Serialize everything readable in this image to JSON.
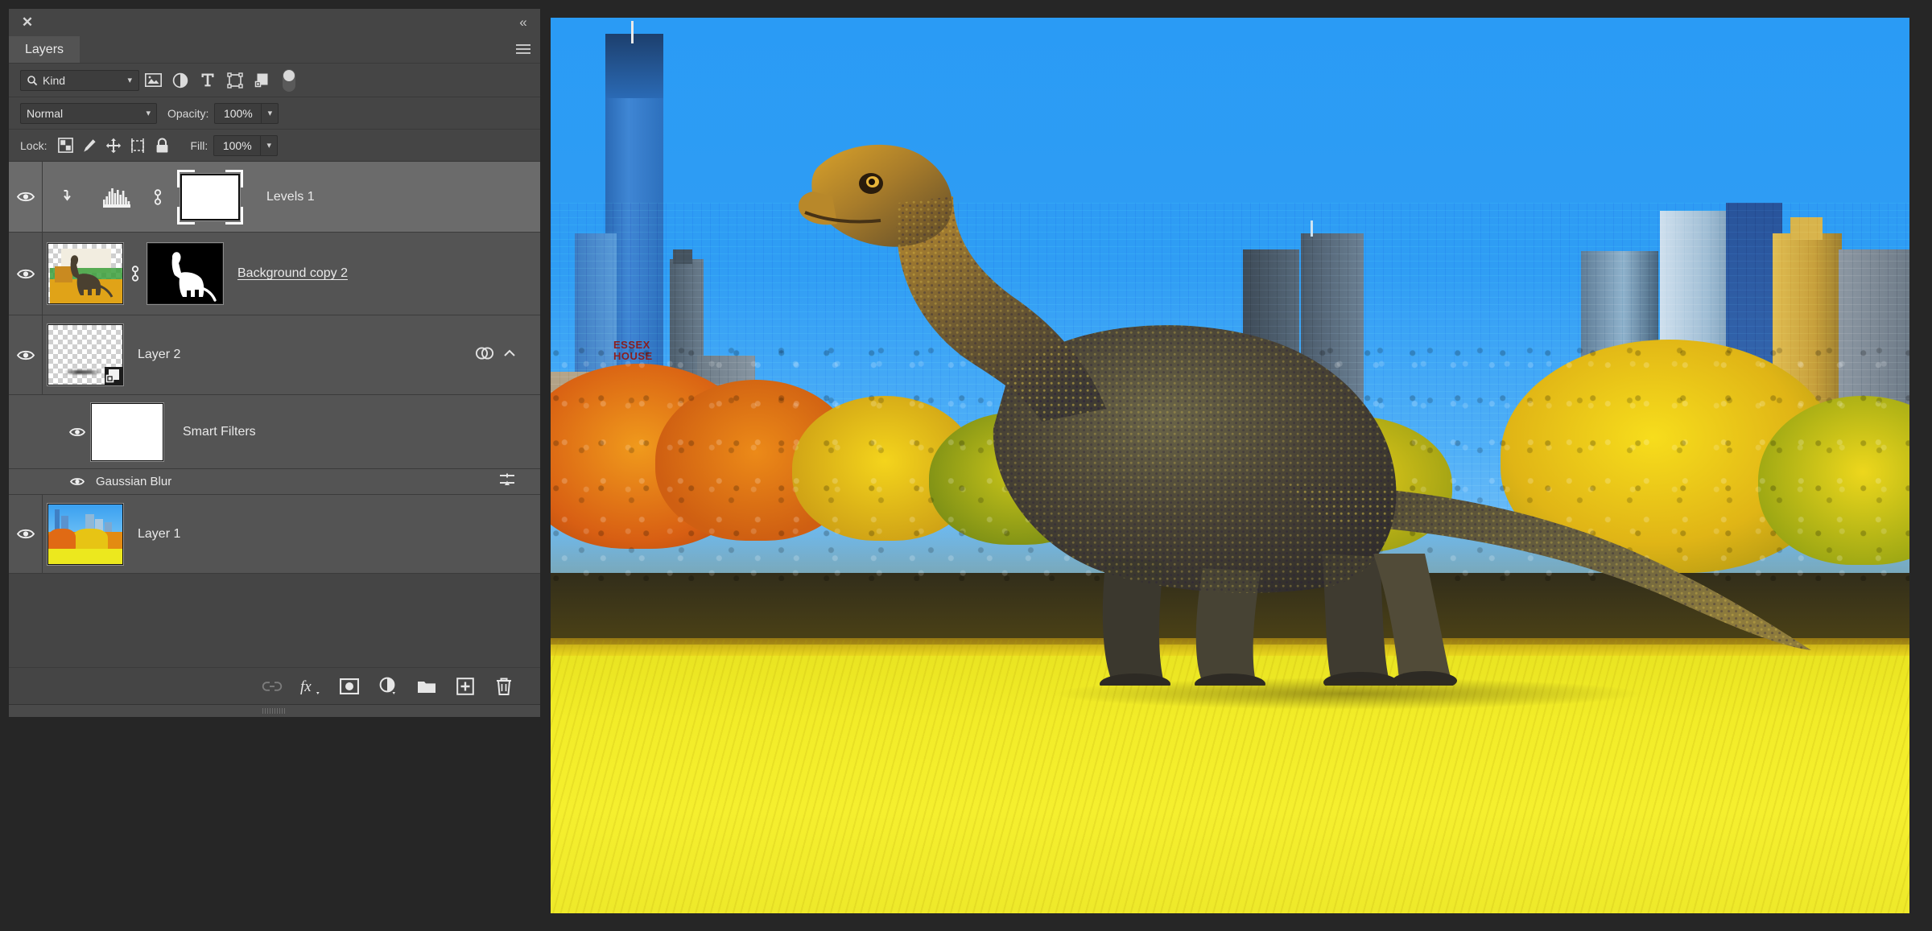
{
  "panel": {
    "title_close_icon": "close-icon",
    "collapse_icon": "collapse-double-chevron",
    "tab_label": "Layers",
    "menu_icon": "panel-menu-icon"
  },
  "filter_bar": {
    "kind_label": "Kind",
    "search_icon": "search-icon",
    "chevron": "⌄",
    "icons": [
      {
        "name": "filter-pixel-layers-icon",
        "title": "Pixel layers"
      },
      {
        "name": "filter-adjustment-layers-icon",
        "title": "Adjustment layers"
      },
      {
        "name": "filter-type-layers-icon",
        "title": "Type layers"
      },
      {
        "name": "filter-shape-layers-icon",
        "title": "Shape layers"
      },
      {
        "name": "filter-smart-object-icon",
        "title": "Smart objects"
      }
    ],
    "toggle_name": "filter-enable-toggle"
  },
  "blend_bar": {
    "mode": "Normal",
    "opacity_label": "Opacity:",
    "opacity_value": "100%",
    "chevron": "⌄"
  },
  "lock_bar": {
    "lock_label": "Lock:",
    "fill_label": "Fill:",
    "fill_value": "100%",
    "icons": [
      {
        "name": "lock-transparent-pixels-icon"
      },
      {
        "name": "lock-image-pixels-icon"
      },
      {
        "name": "lock-position-icon"
      },
      {
        "name": "lock-artboard-nesting-icon"
      },
      {
        "name": "lock-all-icon"
      }
    ]
  },
  "layers": [
    {
      "id": "levels-1",
      "name": "Levels 1",
      "type": "adjustment",
      "selected": true,
      "visible": true,
      "clipped": true,
      "linked": true,
      "mask_selected": true,
      "thumb_kind": "histogram",
      "mask_kind": "white"
    },
    {
      "id": "background-copy-2",
      "name": "Background copy 2",
      "type": "pixel",
      "selected": false,
      "visible": true,
      "editing_name": true,
      "linked": true,
      "thumb_kind": "dino-cutout",
      "mask_kind": "dino-silhouette"
    },
    {
      "id": "layer-2",
      "name": "Layer 2",
      "type": "smart-object",
      "selected": false,
      "visible": true,
      "thumb_kind": "transparent-brush",
      "has_smart_filters": true,
      "expanded": true
    },
    {
      "id": "smart-filters",
      "name": "Smart Filters",
      "type": "smart-filter-group",
      "visible": true,
      "indent": 1,
      "mask_kind": "white"
    },
    {
      "id": "gaussian-blur",
      "name": "Gaussian Blur",
      "type": "smart-filter",
      "visible": true,
      "indent": 2,
      "has_blending_options": true
    },
    {
      "id": "layer-1",
      "name": "Layer 1",
      "type": "pixel",
      "selected": false,
      "visible": true,
      "thumb_kind": "city-park"
    }
  ],
  "bottom_toolbar": [
    {
      "name": "link-layers-button",
      "glyph": "link",
      "disabled": true
    },
    {
      "name": "layer-style-fx-button",
      "glyph": "fx",
      "disabled": false
    },
    {
      "name": "add-layer-mask-button",
      "glyph": "mask",
      "disabled": false
    },
    {
      "name": "new-adjustment-layer-button",
      "glyph": "adjustment",
      "disabled": false
    },
    {
      "name": "new-group-button",
      "glyph": "folder",
      "disabled": false
    },
    {
      "name": "new-layer-button",
      "glyph": "plus-square",
      "disabled": false
    },
    {
      "name": "delete-layer-button",
      "glyph": "trash",
      "disabled": false
    }
  ],
  "canvas": {
    "description": "Composited photo: Central Park skyline with a large sauropod dinosaur standing on bright yellow grass",
    "building_signs": [
      {
        "line1": "ESSEX",
        "line2": "HOUSE"
      },
      {
        "line1": "ESSEX",
        "line2": "HOUSE"
      }
    ],
    "colors": {
      "sky": "#2f9df4",
      "grass": "#f2ec28",
      "tower_blue": "#2f73c4",
      "foliage_yellow": "#f0c418",
      "foliage_orange": "#e8731a",
      "dino_body": "#4a4438"
    }
  }
}
